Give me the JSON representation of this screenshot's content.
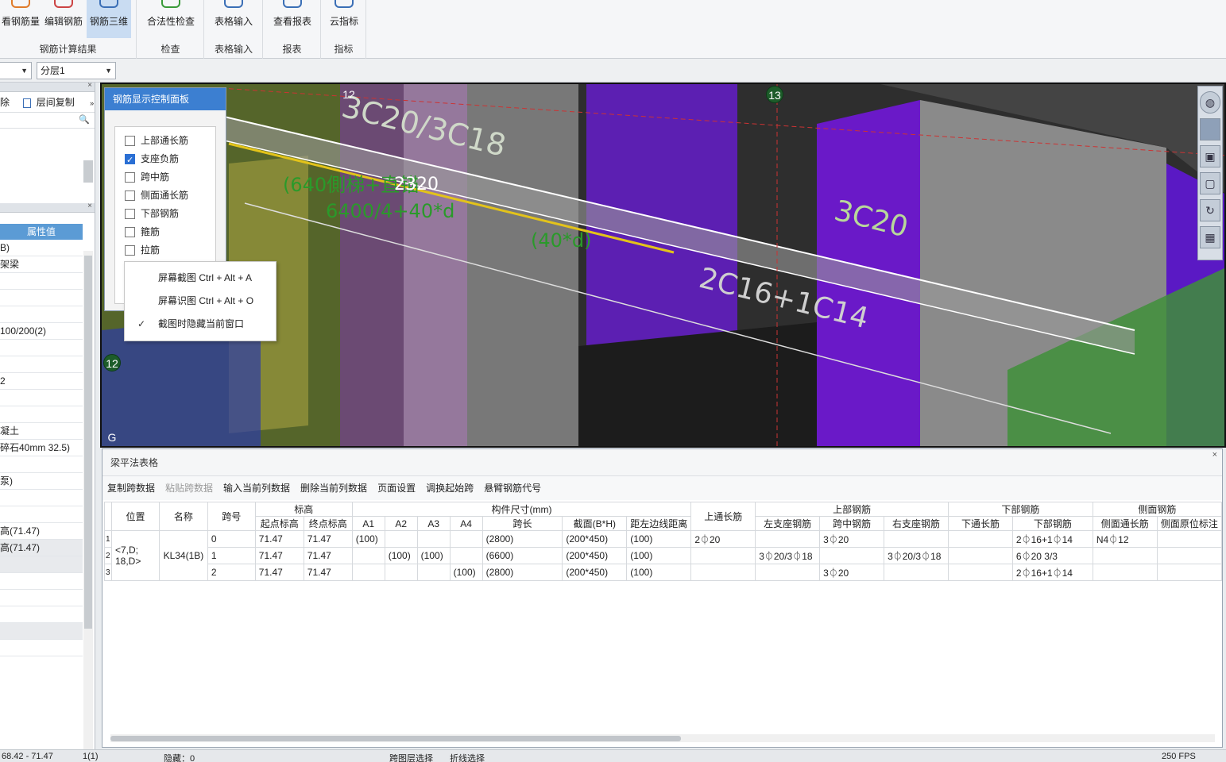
{
  "ribbon": {
    "groups": [
      {
        "title": "钢筋计算结果",
        "buttons": [
          "看钢筋量",
          "编辑钢筋",
          "钢筋三维"
        ]
      },
      {
        "title": "检查",
        "buttons": [
          "合法性检查"
        ]
      },
      {
        "title": "表格输入",
        "buttons": [
          "表格输入"
        ]
      },
      {
        "title": "报表",
        "buttons": [
          "查看报表"
        ]
      },
      {
        "title": "指标",
        "buttons": [
          "云指标"
        ]
      }
    ]
  },
  "subbar": {
    "layer_select": "分层1"
  },
  "left_panel": {
    "tools": [
      "除",
      "层间复制"
    ],
    "prop_header": "属性值",
    "prop_values": [
      "B)",
      "架梁",
      "",
      "",
      "",
      "100/200(2)",
      "",
      "",
      "2",
      "",
      "",
      "凝土",
      "碎石40mm 32.5)",
      "",
      "泵)",
      "",
      "",
      "高(71.47)",
      "高(71.47)",
      "",
      "",
      "",
      "",
      "",
      ""
    ]
  },
  "viewport": {
    "grid_bubbles": [
      "12",
      "13",
      "12",
      "G"
    ],
    "rebar_labels": [
      "3C20/3C18",
      "3C20",
      "2C16+1C14"
    ],
    "dim_labels": [
      "(640側梯+直锚",
      "2320",
      "6400/4+40*d",
      "(40*d)"
    ]
  },
  "control_panel": {
    "title": "钢筋显示控制面板",
    "options": [
      {
        "label": "上部通长筋",
        "checked": false
      },
      {
        "label": "支座负筋",
        "checked": true
      },
      {
        "label": "跨中筋",
        "checked": false
      },
      {
        "label": "侧面通长筋",
        "checked": false
      },
      {
        "label": "下部钢筋",
        "checked": false
      },
      {
        "label": "箍筋",
        "checked": false
      },
      {
        "label": "拉筋",
        "checked": false
      }
    ]
  },
  "context_menu": {
    "items": [
      {
        "label": "屏幕截图 Ctrl + Alt + A",
        "checked": false
      },
      {
        "label": "屏幕识图 Ctrl + Alt + O",
        "checked": false
      },
      {
        "label": "截图时隐藏当前窗口",
        "checked": true
      }
    ]
  },
  "table_panel": {
    "title": "梁平法表格",
    "buttons": [
      {
        "label": "复制跨数据",
        "enabled": true
      },
      {
        "label": "粘贴跨数据",
        "enabled": false
      },
      {
        "label": "输入当前列数据",
        "enabled": true
      },
      {
        "label": "删除当前列数据",
        "enabled": true
      },
      {
        "label": "页面设置",
        "enabled": true
      },
      {
        "label": "调换起始跨",
        "enabled": true
      },
      {
        "label": "悬臂钢筋代号",
        "enabled": true
      }
    ],
    "header1": {
      "pos": "位置",
      "name": "名称",
      "span": "跨号",
      "elev": "标高",
      "dims": "构件尺寸(mm)",
      "top_cont": "上通长筋",
      "top_bar": "上部钢筋",
      "bot_bar": "下部钢筋",
      "side_bar": "侧面钢筋"
    },
    "header2": [
      "起点标高",
      "终点标高",
      "A1",
      "A2",
      "A3",
      "A4",
      "跨长",
      "截面(B*H)",
      "距左边线距离",
      "左支座钢筋",
      "跨中钢筋",
      "右支座钢筋",
      "下通长筋",
      "下部钢筋",
      "侧面通长筋",
      "侧面原位标注"
    ],
    "position": "<7,D; 18,D>",
    "name": "KL34(1B)",
    "rows": [
      {
        "idx": "1",
        "span": "0",
        "start": "71.47",
        "end": "71.47",
        "a1": "(100)",
        "a2": "",
        "a3": "",
        "a4": "",
        "len": "(2800)",
        "sec": "(200*450)",
        "dist": "(100)",
        "topcont": "2⏀20",
        "left": "",
        "mid": "3⏀20",
        "right": "",
        "botcont": "",
        "bot": "2⏀16+1⏀14",
        "sidecont": "N4⏀12",
        "sideann": ""
      },
      {
        "idx": "2",
        "span": "1",
        "start": "71.47",
        "end": "71.47",
        "a1": "",
        "a2": "(100)",
        "a3": "(100)",
        "a4": "",
        "len": "(6600)",
        "sec": "(200*450)",
        "dist": "(100)",
        "topcont": "",
        "left": "3⏀20/3⏀18",
        "mid": "",
        "right": "3⏀20/3⏀18",
        "botcont": "",
        "bot": "6⏀20 3/3",
        "sidecont": "",
        "sideann": ""
      },
      {
        "idx": "3",
        "span": "2",
        "start": "71.47",
        "end": "71.47",
        "a1": "",
        "a2": "",
        "a3": "",
        "a4": "(100)",
        "len": "(2800)",
        "sec": "(200*450)",
        "dist": "(100)",
        "topcont": "",
        "left": "",
        "mid": "3⏀20",
        "right": "",
        "botcont": "",
        "bot": "2⏀16+1⏀14",
        "sidecont": "",
        "sideann": ""
      }
    ]
  },
  "status": {
    "coords": "68.42 - 71.47",
    "page": "1(1)",
    "hidden": "隐藏：0",
    "btn1": "跨图层选择",
    "btn2": "折线选择",
    "fps": "250 FPS"
  }
}
